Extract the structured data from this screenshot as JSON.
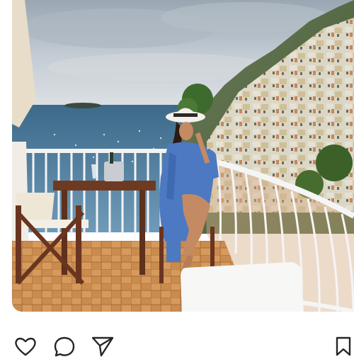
{
  "post": {
    "actions": {
      "like_icon": "heart-icon",
      "comment_icon": "comment-icon",
      "share_icon": "send-icon",
      "save_icon": "bookmark-icon"
    }
  },
  "colors": {
    "icon_stroke": "#262626",
    "background": "#ffffff"
  }
}
